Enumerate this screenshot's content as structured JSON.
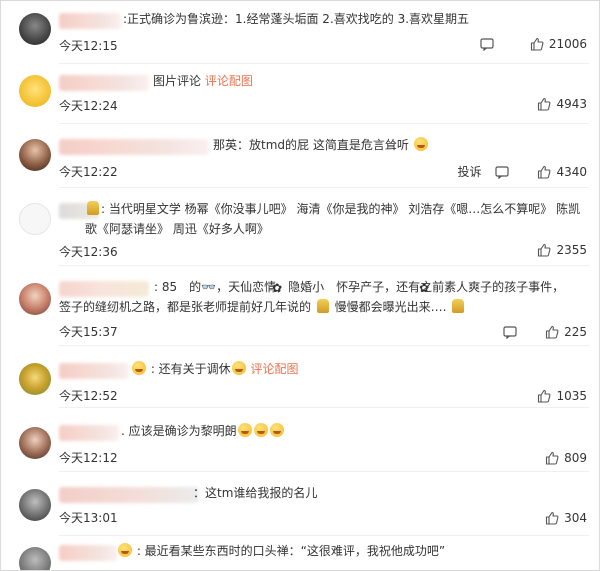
{
  "comments": [
    {
      "text_parts": [
        ":正式确诊为鲁滨逊：1.经常蓬头垢面 2.喜欢找吃的 3.喜欢星期五"
      ],
      "time": "今天12:15",
      "likes": "21006"
    },
    {
      "text_parts": [
        "图片评论 ",
        "评论配图"
      ],
      "time": "今天12:24",
      "likes": "4943"
    },
    {
      "text_parts": [
        "那英：放tmd的屁 这简直是危言耸听"
      ],
      "time": "今天12:22",
      "report": "投诉",
      "likes": "4340"
    },
    {
      "text_parts": [
        ": 当代明星文学 杨幂《你没事儿吧》 海清《你是我的神》 刘浩存《嗯…怎么不算呢》 陈凯歌《阿瑟请坐》 周迅《好多人啊》"
      ],
      "time": "今天12:36",
      "likes": "2355"
    },
    {
      "text_parts": [
        ": 85",
        "的",
        "，天仙恋情，隐婚小",
        "怀孕产子，还有之前素人爽子的孩子事件，签子的缝纫机之路，都是张老师提前好几年说的 ",
        " 慢慢都会曝光出来…. "
      ],
      "time": "今天15:37",
      "likes": "225"
    },
    {
      "text_parts": [
        ": 还有关于调休",
        " ",
        "评论配图"
      ],
      "time": "今天12:52",
      "likes": "1035"
    },
    {
      "text_parts": ". 应该是确诊为黎明朗",
      "time": "今天12:12",
      "likes": "809"
    },
    {
      "text_parts": "：这tm谁给我报的名儿",
      "time": "今天13:01",
      "likes": "304"
    },
    {
      "text_parts": ": 最近看某些东西时的口头禅：“这很难评，我祝他成功吧”",
      "time": "",
      "likes": ""
    }
  ],
  "colors": {
    "link": "#eb7350",
    "text": "#333333",
    "border": "#d9d9d9"
  },
  "icons": [
    "comment-icon",
    "like-icon"
  ]
}
